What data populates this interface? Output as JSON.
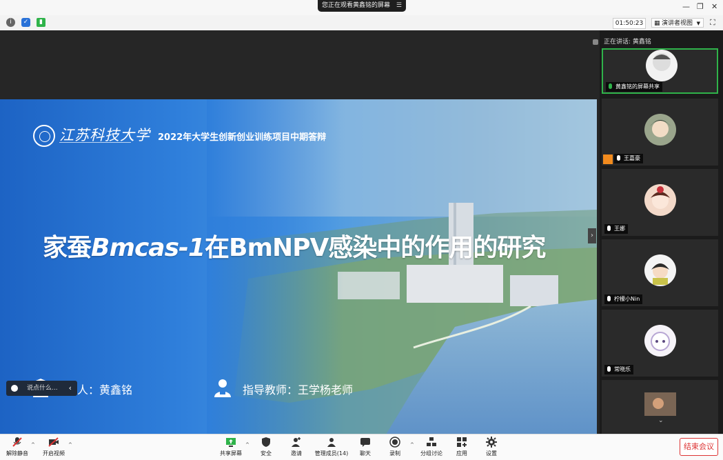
{
  "window": {
    "share_notice": "您正在观看黄鑫铭的屏幕",
    "timer": "01:50:23",
    "view_button": "演讲者视图"
  },
  "slide": {
    "university_name": "江苏科技大学",
    "header": "2022年大学生创新创业训练项目中期答辩",
    "title_prefix": "家蚕",
    "title_italic": "Bmcas-1",
    "title_suffix": "在BmNPV感染中的作用的研究",
    "speaker": "答辩人：黄鑫铭",
    "advisor": "指导教师：王学杨老师"
  },
  "chat": {
    "placeholder": "说点什么..."
  },
  "sidebar": {
    "speaking": "正在讲话: 黄鑫铭",
    "participants": [
      {
        "name": "黄鑫铭的屏幕共享",
        "mic": "green"
      },
      {
        "name": "王嘉豪",
        "mic": "white"
      },
      {
        "name": "王娜",
        "mic": "white"
      },
      {
        "name": "柠檬小Nin",
        "mic": "white"
      },
      {
        "name": "常晓乐",
        "mic": "white"
      },
      {
        "name": "",
        "mic": "none"
      }
    ]
  },
  "toolbar": {
    "unmute": "解除静音",
    "start_video": "开启视频",
    "share_screen": "共享屏幕",
    "security": "安全",
    "invite": "邀请",
    "participants": "管理成员(14)",
    "chat": "聊天",
    "record": "录制",
    "breakout": "分组讨论",
    "apps": "应用",
    "settings": "设置",
    "end_meeting": "结束会议"
  },
  "colors": {
    "accent_green": "#2fb34a",
    "end_red": "#d33333",
    "slide_blue": "#1d63c4"
  }
}
